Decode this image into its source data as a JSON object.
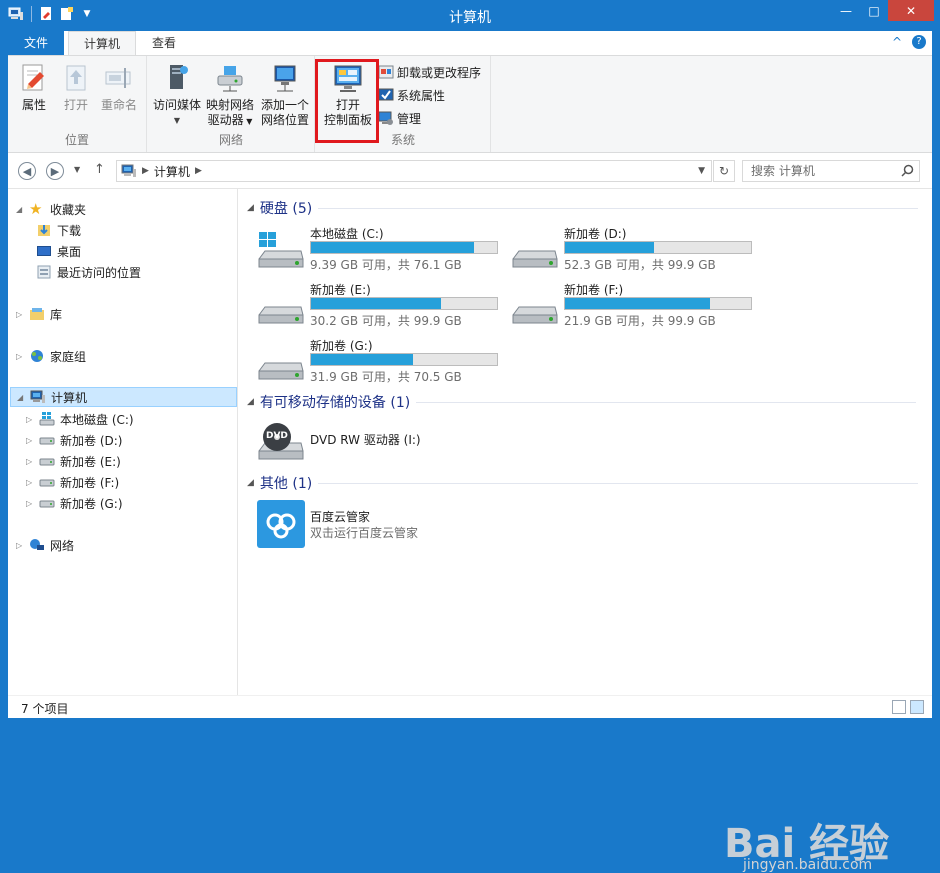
{
  "window": {
    "title": "计算机",
    "controls": {
      "minimize": "—",
      "maximize": "□",
      "close": "✕"
    }
  },
  "ribbon_tabs": {
    "file": "文件",
    "computer": "计算机",
    "view": "查看",
    "collapse": "^",
    "help": "?"
  },
  "ribbon": {
    "location_group": {
      "label": "位置",
      "properties": "属性",
      "open": "打开",
      "rename": "重命名"
    },
    "network_group": {
      "label": "网络",
      "access_media": "访问媒体",
      "map_drive_line1": "映射网络",
      "map_drive_line2": "驱动器",
      "add_location_line1": "添加一个",
      "add_location_line2": "网络位置"
    },
    "system_group": {
      "label": "系统",
      "open_cp_line1": "打开",
      "open_cp_line2": "控制面板",
      "uninstall": "卸载或更改程序",
      "system_props": "系统属性",
      "manage": "管理"
    }
  },
  "address": {
    "path": "计算机",
    "search_placeholder": "搜索 计算机"
  },
  "nav": {
    "favorites": "收藏夹",
    "downloads": "下载",
    "desktop": "桌面",
    "recent": "最近访问的位置",
    "libraries": "库",
    "homegroup": "家庭组",
    "computer": "计算机",
    "drives": [
      "本地磁盘 (C:)",
      "新加卷 (D:)",
      "新加卷 (E:)",
      "新加卷 (F:)",
      "新加卷 (G:)"
    ],
    "network": "网络"
  },
  "sections": {
    "hard_disks": "硬盘 (5)",
    "removable": "有可移动存储的设备 (1)",
    "other": "其他 (1)"
  },
  "drives": [
    {
      "name": "本地磁盘 (C:)",
      "free": "9.39 GB 可用，共 76.1 GB",
      "used_fraction": 0.877
    },
    {
      "name": "新加卷 (D:)",
      "free": "52.3 GB 可用，共 99.9 GB",
      "used_fraction": 0.476
    },
    {
      "name": "新加卷 (E:)",
      "free": "30.2 GB 可用，共 99.9 GB",
      "used_fraction": 0.698
    },
    {
      "name": "新加卷 (F:)",
      "free": "21.9 GB 可用，共 99.9 GB",
      "used_fraction": 0.781
    },
    {
      "name": "新加卷 (G:)",
      "free": "31.9 GB 可用，共 70.5 GB",
      "used_fraction": 0.548
    }
  ],
  "dvd": {
    "name": "DVD RW 驱动器 (I:)",
    "label": "DVD"
  },
  "other_item": {
    "name": "百度云管家",
    "desc": "双击运行百度云管家"
  },
  "status": {
    "count": "7 个项目"
  },
  "watermark": {
    "main": "Bai 经验",
    "sub": "jingyan.baidu.com"
  },
  "colors": {
    "accent": "#1979ca",
    "bar_fill": "#26a0da",
    "highlight": "#e0191e"
  }
}
